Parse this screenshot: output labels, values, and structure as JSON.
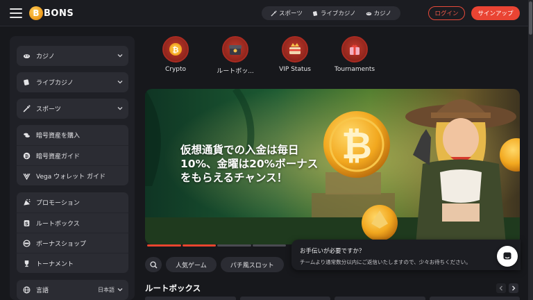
{
  "header": {
    "brand": "BONS",
    "brand_initial": "B",
    "nav": [
      {
        "label": "スポーツ",
        "icon": "sports-icon"
      },
      {
        "label": "ライブカジノ",
        "icon": "live-casino-icon"
      },
      {
        "label": "カジノ",
        "icon": "casino-icon"
      }
    ],
    "login_label": "ログイン",
    "signup_label": "サインアップ",
    "accent_color": "#ea4433"
  },
  "sidebar": {
    "group1": [
      {
        "label": "カジノ",
        "icon": "casino-icon"
      }
    ],
    "group2": [
      {
        "label": "ライブカジノ",
        "icon": "live-casino-icon"
      }
    ],
    "group3": [
      {
        "label": "スポーツ",
        "icon": "sports-icon"
      }
    ],
    "crypto": [
      {
        "label": "暗号資産を購入",
        "icon": "buy-crypto-icon"
      },
      {
        "label": "暗号資産ガイド",
        "icon": "bitcoin-icon"
      },
      {
        "label": "Vega ウォレット ガイド",
        "icon": "wallet-icon"
      }
    ],
    "promo": [
      {
        "label": "プロモーション",
        "icon": "promotion-icon"
      },
      {
        "label": "ルートボックス",
        "icon": "lootbox-icon"
      },
      {
        "label": "ボーナスショップ",
        "icon": "bonus-shop-icon"
      },
      {
        "label": "トーナメント",
        "icon": "trophy-icon"
      }
    ],
    "language_label": "言語",
    "language_value": "日本語"
  },
  "categories": [
    {
      "label": "Crypto",
      "icon": "crypto-icon"
    },
    {
      "label": "ルートボッ...",
      "icon": "lootbox-icon"
    },
    {
      "label": "VIP Status",
      "icon": "vip-icon"
    },
    {
      "label": "Tournaments",
      "icon": "tournaments-icon"
    }
  ],
  "banner": {
    "line1": "仮想通貨での入金は毎日",
    "line2": "10%、金曜は20%ボーナス",
    "line3": "をもらえるチャンス！",
    "slides_active": 2,
    "slides_total": 4
  },
  "filters": [
    "人気ゲーム",
    "パチ風スロット"
  ],
  "section": {
    "title": "ルートボックス"
  },
  "help": {
    "title": "お手伝いが必要ですか？",
    "body": "チームより通常数分以内にご返信いたしますので、少々お待ちください。"
  }
}
